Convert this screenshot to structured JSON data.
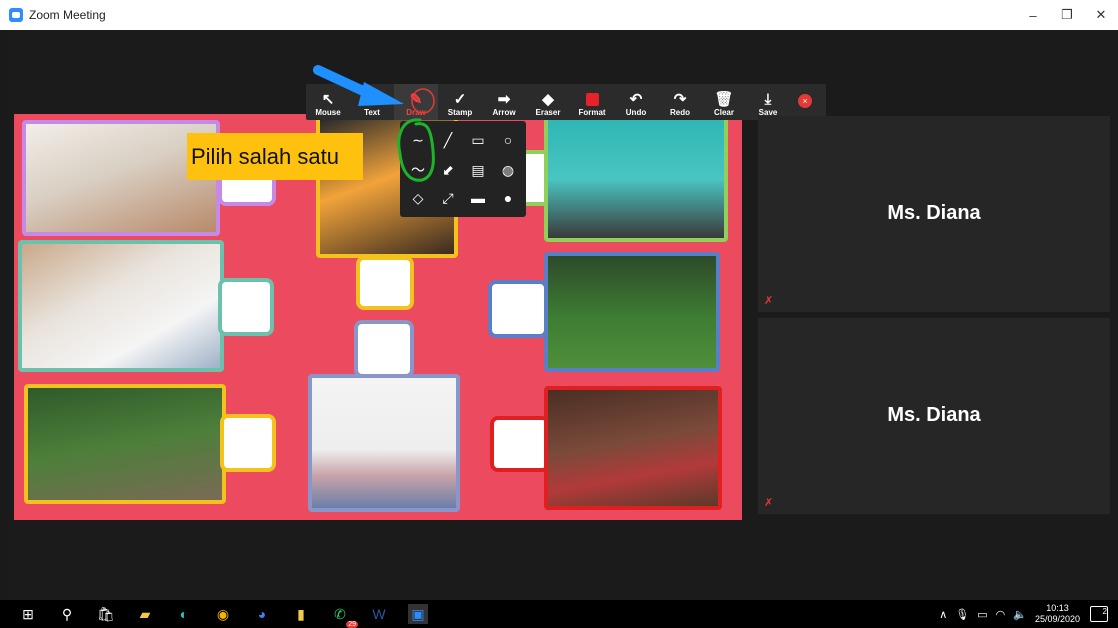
{
  "window": {
    "title": "Zoom Meeting",
    "controls": [
      "–",
      "❐",
      "✕"
    ]
  },
  "toolbar": {
    "tools": [
      {
        "label": "Mouse",
        "icon": "mouse-pointer-icon",
        "glyph": "↖"
      },
      {
        "label": "Text",
        "icon": "text-icon",
        "glyph": "T"
      },
      {
        "label": "Draw",
        "icon": "draw-icon",
        "glyph": "✎",
        "active": true
      },
      {
        "label": "Stamp",
        "icon": "stamp-icon",
        "glyph": "✓"
      },
      {
        "label": "Arrow",
        "icon": "arrow-icon",
        "glyph": "➡"
      },
      {
        "label": "Eraser",
        "icon": "eraser-icon",
        "glyph": "◆"
      },
      {
        "label": "Format",
        "icon": "format-swatch-icon",
        "color": "#e8222b"
      },
      {
        "label": "Undo",
        "icon": "undo-icon",
        "glyph": "↶"
      },
      {
        "label": "Redo",
        "icon": "redo-icon",
        "glyph": "↷"
      },
      {
        "label": "Clear",
        "icon": "trash-icon",
        "glyph": "🗑"
      },
      {
        "label": "Save",
        "icon": "save-icon",
        "glyph": "⤓"
      }
    ],
    "close_icon": "×"
  },
  "draw_menu": {
    "items": [
      {
        "name": "thin-freehand-icon",
        "glyph": "∼"
      },
      {
        "name": "thin-line-icon",
        "glyph": "╱"
      },
      {
        "name": "rectangle-outline-icon",
        "glyph": "▭"
      },
      {
        "name": "ellipse-outline-icon",
        "glyph": "○"
      },
      {
        "name": "thick-freehand-icon",
        "glyph": "〜"
      },
      {
        "name": "thick-line-icon",
        "glyph": "⬋"
      },
      {
        "name": "semi-rectangle-icon",
        "glyph": "▤"
      },
      {
        "name": "semi-ellipse-icon",
        "glyph": "◍"
      },
      {
        "name": "diamond-outline-icon",
        "glyph": "◇"
      },
      {
        "name": "double-arrow-icon",
        "glyph": "⤢"
      },
      {
        "name": "filled-rectangle-icon",
        "glyph": "▬"
      },
      {
        "name": "filled-ellipse-icon",
        "glyph": "●"
      }
    ]
  },
  "callout": {
    "text": "Pilih salah satu"
  },
  "participants": [
    {
      "name": "Ms. Diana"
    },
    {
      "name": "Ms. Diana"
    }
  ],
  "colors": {
    "share_background": "#ec4a5f",
    "callout": "#fec10e",
    "annotation_green": "#1db32a",
    "annotation_blue": "#1e90ff",
    "active_tool": "#ff4040"
  },
  "taskbar": {
    "icons": [
      "windows-start-icon",
      "search-icon",
      "store-icon",
      "file-explorer-icon",
      "edge-icon",
      "chrome-icon",
      "browser-icon",
      "sticky-notes-icon",
      "whatsapp-icon",
      "word-icon",
      "zoom-icon"
    ],
    "whatsapp_badge": "29",
    "clock_time": "10:13",
    "clock_date": "25/09/2020",
    "notification_count": "2"
  }
}
